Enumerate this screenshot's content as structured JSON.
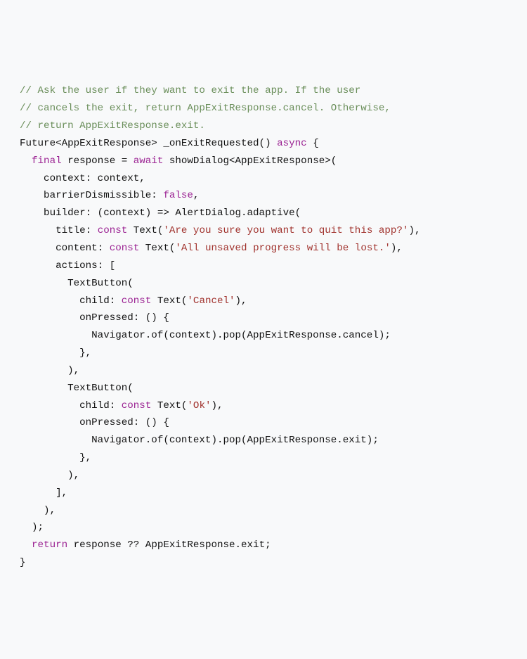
{
  "code": {
    "comments": {
      "l1": "// Ask the user if they want to exit the app. If the user",
      "l2": "// cancels the exit, return AppExitResponse.cancel. Otherwise,",
      "l3": "// return AppExitResponse.exit."
    },
    "keywords": {
      "final": "final",
      "await": "await",
      "const1": "const",
      "const2": "const",
      "const3": "const",
      "const4": "const",
      "async": "async",
      "return": "return",
      "false": "false"
    },
    "strings": {
      "title": "'Are you sure you want to quit this app?'",
      "content": "'All unsaved progress will be lost.'",
      "cancel": "'Cancel'",
      "ok": "'Ok'"
    },
    "text": {
      "l4a": "Future<AppExitResponse> _onExitRequested() ",
      "l4b": " {",
      "l5a": "  ",
      "l5b": " response = ",
      "l5c": " showDialog<AppExitResponse>(",
      "l6": "    context: context,",
      "l7a": "    barrierDismissible: ",
      "l7b": ",",
      "l8": "    builder: (context) => AlertDialog.adaptive(",
      "l9a": "      title: ",
      "l9b": " Text(",
      "l9c": "),",
      "l10a": "      content: ",
      "l10b": " Text(",
      "l10c": "),",
      "l11": "      actions: [",
      "l12": "        TextButton(",
      "l13a": "          child: ",
      "l13b": " Text(",
      "l13c": "),",
      "l14": "          onPressed: () {",
      "l15": "            Navigator.of(context).pop(AppExitResponse.cancel);",
      "l16": "          },",
      "l17": "        ),",
      "l18": "        TextButton(",
      "l19a": "          child: ",
      "l19b": " Text(",
      "l19c": "),",
      "l20": "          onPressed: () {",
      "l21": "            Navigator.of(context).pop(AppExitResponse.exit);",
      "l22": "          },",
      "l23": "        ),",
      "l24": "      ],",
      "l25": "    ),",
      "l26": "  );",
      "l27": "",
      "l28a": "  ",
      "l28b": " response ?? AppExitResponse.exit;",
      "l29": "}"
    }
  }
}
